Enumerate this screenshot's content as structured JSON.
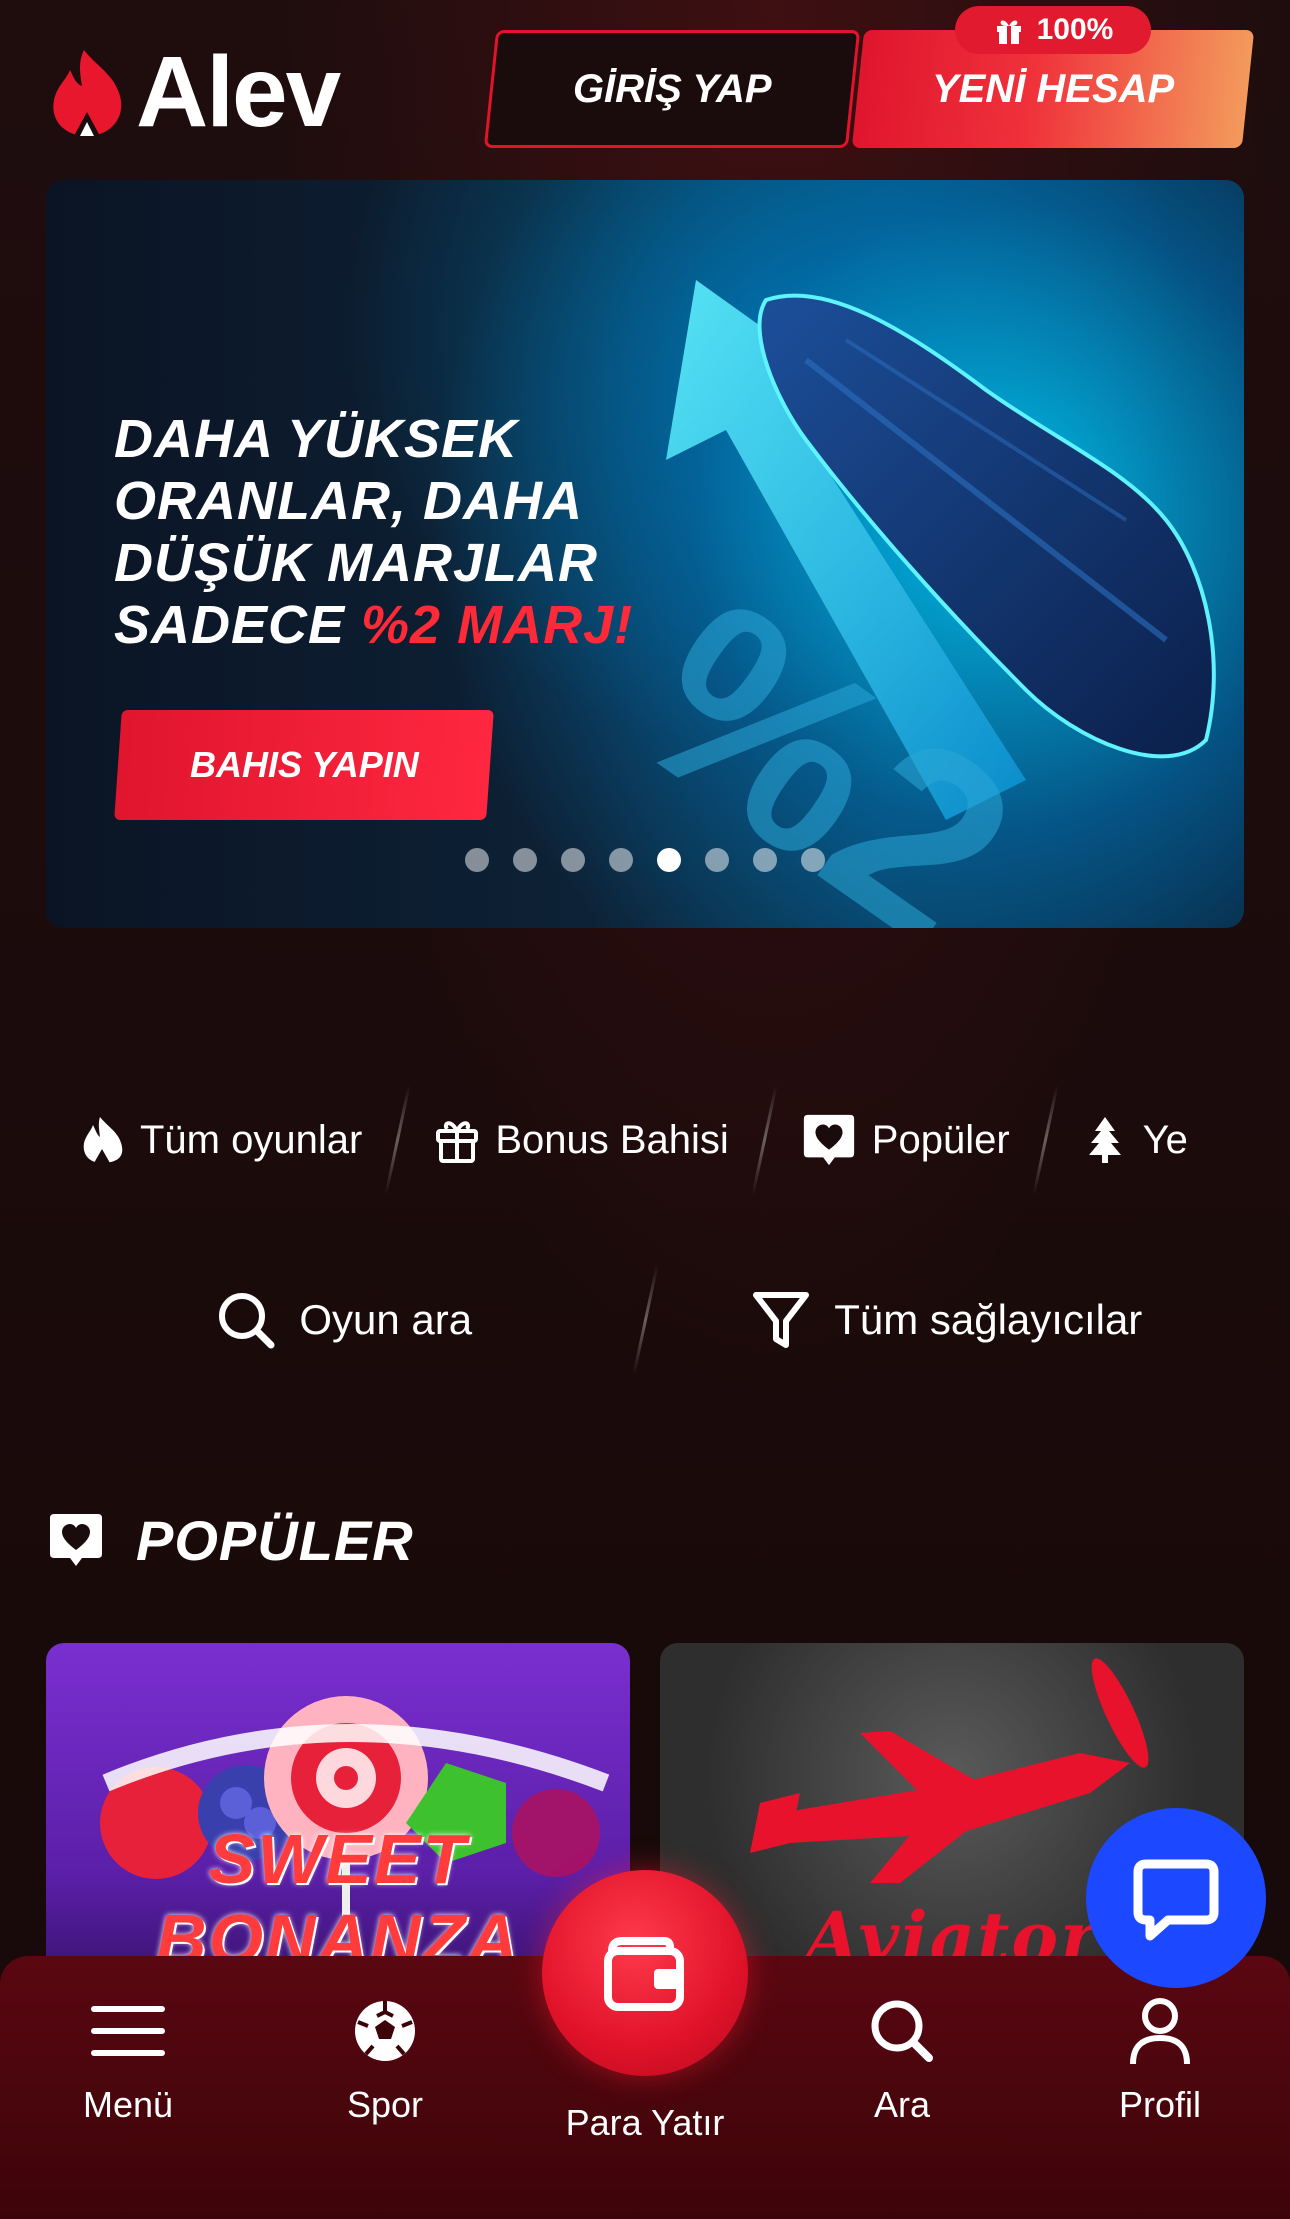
{
  "header": {
    "logo_text": "Alev",
    "login_label": "GİRİŞ YAP",
    "register_label": "YENİ HESAP",
    "bonus_badge": "100%"
  },
  "banner": {
    "headline_lines": [
      "DAHA YÜKSEK",
      "ORANLAR, DAHA",
      "DÜŞÜK MARJLAR"
    ],
    "headline_last_prefix": "SADECE ",
    "headline_last_highlight": "%2 MARJ!",
    "cta_label": "BAHIS YAPIN",
    "slide_count": 8,
    "active_slide": 5
  },
  "categories": [
    {
      "label": "Tüm oyunlar",
      "icon": "flame-icon"
    },
    {
      "label": "Bonus Bahisi",
      "icon": "gift-icon"
    },
    {
      "label": "Popüler",
      "icon": "heart-badge-icon"
    },
    {
      "label": "Ye",
      "icon": "tree-icon"
    }
  ],
  "search": {
    "search_label": "Oyun ara",
    "providers_label": "Tüm sağlayıcılar"
  },
  "section": {
    "title": "POPÜLER"
  },
  "games": [
    {
      "title": "SWEET BONANZA"
    },
    {
      "title": "Aviator"
    }
  ],
  "bottom_nav": {
    "menu": "Menü",
    "spor": "Spor",
    "deposit": "Para Yatır",
    "ara": "Ara",
    "profil": "Profil"
  },
  "colors": {
    "background": "#1a0b0c",
    "accent_red": "#e0152e",
    "chat_blue": "#1c49ff",
    "nav_bg": "#4a0510"
  }
}
